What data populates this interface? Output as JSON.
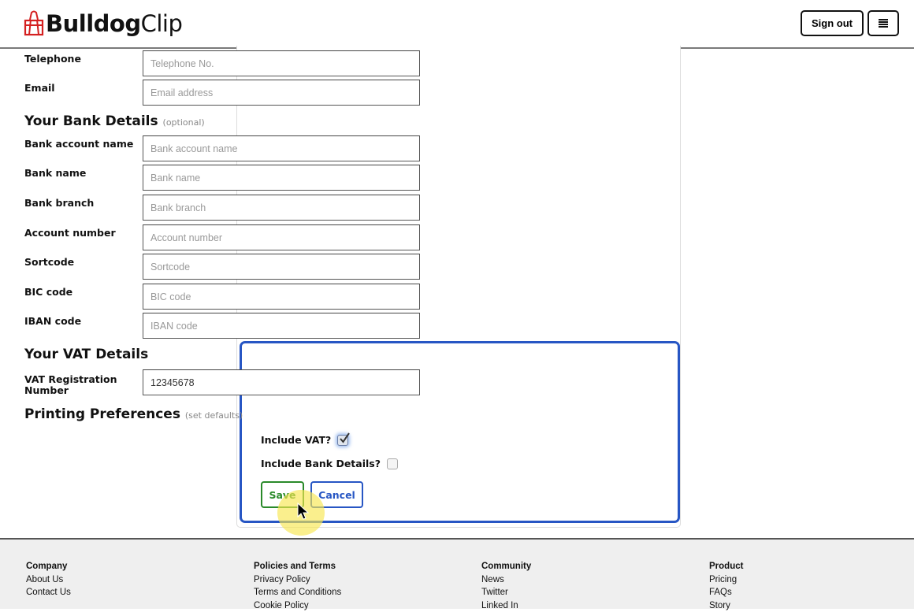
{
  "header": {
    "logo_bold": "Bulldog",
    "logo_light": "Clip",
    "logo_icon": "binder-clip-icon",
    "sign_out_label": "Sign out",
    "menu_icon": "hamburger-menu-icon",
    "brand_color": "#d42020"
  },
  "contact": {
    "fields": [
      {
        "label": "Telephone",
        "placeholder": "Telephone No.",
        "value": ""
      },
      {
        "label": "Email",
        "placeholder": "Email address",
        "value": ""
      }
    ]
  },
  "bank": {
    "title": "Your Bank Details",
    "note": "(optional)",
    "fields": [
      {
        "label": "Bank account name",
        "placeholder": "Bank account name",
        "value": ""
      },
      {
        "label": "Bank name",
        "placeholder": "Bank name",
        "value": ""
      },
      {
        "label": "Bank branch",
        "placeholder": "Bank branch",
        "value": ""
      },
      {
        "label": "Account number",
        "placeholder": "Account number",
        "value": ""
      },
      {
        "label": "Sortcode",
        "placeholder": "Sortcode",
        "value": ""
      },
      {
        "label": "BIC code",
        "placeholder": "BIC code",
        "value": ""
      },
      {
        "label": "IBAN code",
        "placeholder": "IBAN code",
        "value": ""
      }
    ]
  },
  "vat": {
    "title": "Your VAT Details",
    "reg_label_line1": "VAT Registration",
    "reg_label_line2": "Number",
    "reg_value": "12345678"
  },
  "printing": {
    "title": "Printing Preferences",
    "note": "(set defaults)",
    "include_vat_label": "Include VAT?",
    "include_vat_checked": true,
    "include_bank_label": "Include Bank Details?",
    "include_bank_checked": false
  },
  "actions": {
    "save_label": "Save",
    "cancel_label": "Cancel",
    "save_color": "#2a8a2a",
    "cancel_color": "#2756c4",
    "highlight_color": "#2756c4"
  },
  "footer": {
    "columns": [
      {
        "heading": "Company",
        "links": [
          "About Us",
          "Contact Us"
        ]
      },
      {
        "heading": "Policies and Terms",
        "links": [
          "Privacy Policy",
          "Terms and Conditions",
          "Cookie Policy"
        ]
      },
      {
        "heading": "Community",
        "links": [
          "News",
          "Twitter",
          "Linked In"
        ]
      },
      {
        "heading": "Product",
        "links": [
          "Pricing",
          "FAQs",
          "Story"
        ]
      }
    ]
  }
}
